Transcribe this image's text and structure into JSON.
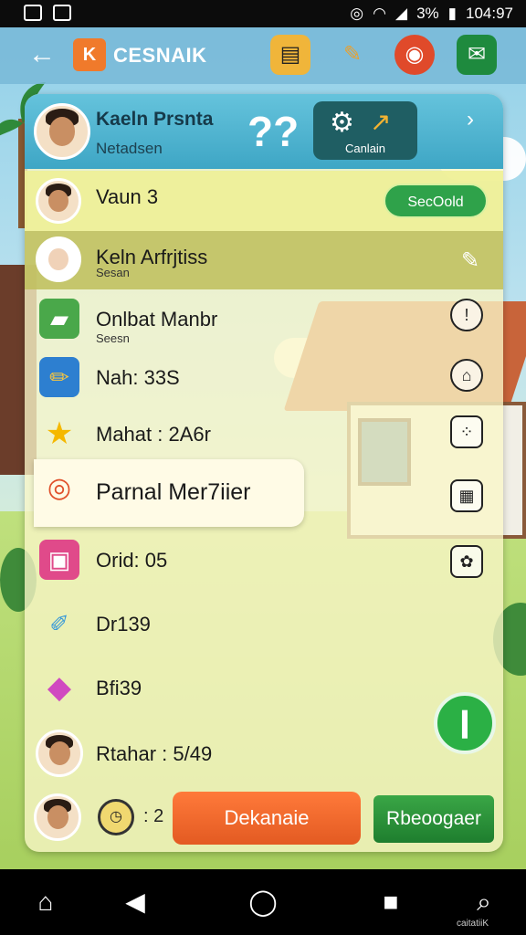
{
  "status_bar": {
    "battery": "3%",
    "time": "104:97"
  },
  "app_bar": {
    "title": "CESNAIK",
    "logo_glyph": "K"
  },
  "header": {
    "name": "Kaeln Prsnta",
    "subtitle": "Netadsen",
    "question_mark": "??",
    "button_label": "Canlain"
  },
  "rows": [
    {
      "title": "Vaun 3",
      "pill": "SecOold"
    },
    {
      "title": "Keln Arfrjtiss",
      "subtitle": "Sesan"
    }
  ],
  "items": [
    {
      "text": "Onlbat Manbr",
      "sub": "Seesn"
    },
    {
      "text": "Nah: 33S"
    },
    {
      "text": "Mahat : 2A6r"
    },
    {
      "text": "Parnal Mer7iier"
    },
    {
      "text": "Orid: 05"
    },
    {
      "text": "Dr139"
    },
    {
      "text": "Bfi39"
    },
    {
      "text": "Rtahar : 5/49"
    }
  ],
  "bottom": {
    "timer_value": ": 2",
    "primary_button": "Dekanaie",
    "secondary_button": "Rbeoogaer"
  },
  "nav": {
    "caption": "caitatiiK"
  },
  "colors": {
    "accent_green": "#2bb045",
    "accent_orange": "#f07a2b",
    "header_teal": "#3ea6c5"
  }
}
